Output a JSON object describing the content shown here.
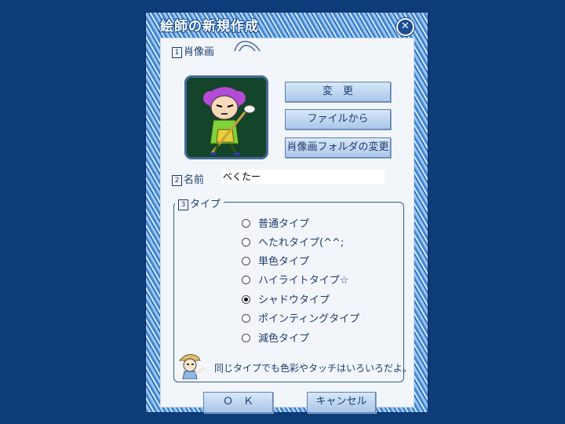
{
  "dialog": {
    "title": "絵師の新規作成",
    "close_glyph": "✕"
  },
  "portrait_section": {
    "number": "1",
    "label": "肖像画",
    "buttons": {
      "change": "変　更",
      "from_file": "ファイルから",
      "change_folder": "肖像画フォルダの変更"
    }
  },
  "name_section": {
    "number": "2",
    "label": "名前",
    "value": "べくたー"
  },
  "type_section": {
    "number": "3",
    "label": "タイプ",
    "options": [
      {
        "label": "普通タイプ",
        "selected": false
      },
      {
        "label": "へたれタイプ(^^;",
        "selected": false
      },
      {
        "label": "単色タイプ",
        "selected": false
      },
      {
        "label": "ハイライトタイプ☆",
        "selected": false
      },
      {
        "label": "シャドウタイプ",
        "selected": true
      },
      {
        "label": "ポインティングタイプ",
        "selected": false
      },
      {
        "label": "減色タイプ",
        "selected": false
      }
    ],
    "hint": "同じタイプでも色彩やタッチはいろいろだよ。"
  },
  "footer": {
    "ok": "Ｏ　Ｋ",
    "cancel": "キャンセル"
  },
  "colors": {
    "desktop": "#0d3c7a",
    "panel": "#f2f6fb",
    "text": "#1d3c6e",
    "button_top": "#d8e7f8",
    "button_bottom": "#a9c7ea"
  },
  "icons": [
    "close-icon",
    "radio-icon",
    "character-illustration",
    "guide-character-icon"
  ]
}
